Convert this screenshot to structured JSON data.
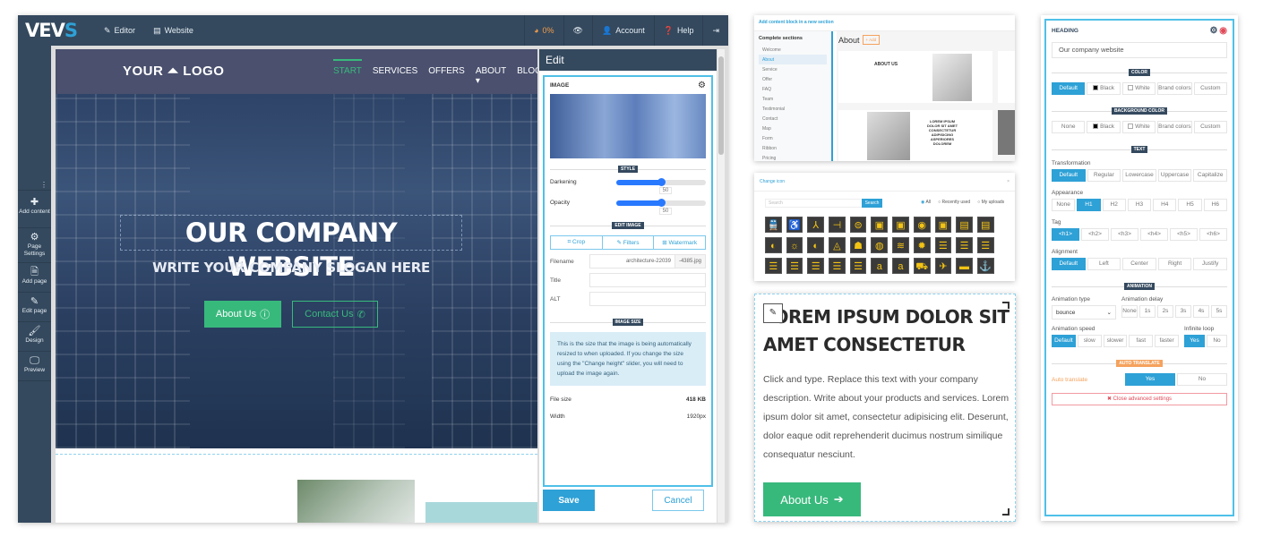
{
  "editor": {
    "topbar": {
      "logo": "VEV",
      "logo_accent": "S",
      "editor_label": "Editor",
      "website_label": "Website",
      "progress_label": "0%",
      "account_label": "Account",
      "help_label": "Help"
    },
    "sidebar": {
      "items": [
        {
          "label": "Add content",
          "icon": "plus-icon"
        },
        {
          "label": "Page Settings",
          "icon": "cogs-icon"
        },
        {
          "label": "Add page",
          "icon": "file-icon"
        },
        {
          "label": "Edit page",
          "icon": "pencil-icon"
        },
        {
          "label": "Design",
          "icon": "brush-icon"
        },
        {
          "label": "Preview",
          "icon": "monitor-icon"
        }
      ]
    },
    "site": {
      "logo_left": "YOUR",
      "logo_right": "LOGO",
      "menu": [
        "START",
        "SERVICES",
        "OFFERS",
        "ABOUT",
        "BLOG"
      ],
      "active_menu": "START",
      "hero_title": "OUR COMPANY WEBSITE",
      "hero_subtitle": "WRITE YOUR COMPANY SLOGAN HERE",
      "btn_about": "About Us",
      "btn_contact": "Contact Us"
    },
    "edit_panel": {
      "title": "Edit",
      "block_title": "IMAGE",
      "style_label": "STYLE",
      "darkening_label": "Darkening",
      "darkening_value": "50",
      "opacity_label": "Opacity",
      "opacity_value": "50",
      "edit_image_label": "EDIT IMAGE",
      "tabs": [
        "Crop",
        "Filters",
        "Watermark"
      ],
      "filename_label": "Filename",
      "filename_value": "architecture-22039",
      "filename_ext": "-4385.jpg",
      "title_label": "Title",
      "alt_label": "ALT",
      "image_size_label": "IMAGE SIZE",
      "info_text": "This is the size that the image is being automatically resized to when uploaded. If you change the size using the \"Change height\" slider, you will need to upload the image again.",
      "file_size_label": "File size",
      "file_size_value": "418 KB",
      "width_label": "Width",
      "width_value": "1920px",
      "save_label": "Save",
      "cancel_label": "Cancel"
    }
  },
  "add_content": {
    "header": "Add content block in a new section",
    "sidebar_title": "Complete sections",
    "sections": [
      "Welcome",
      "About",
      "Service",
      "Offer",
      "FAQ",
      "Team",
      "Testimonial",
      "Contact",
      "Map",
      "Form",
      "Ribbon",
      "Pricing"
    ],
    "selected": "About",
    "main_title": "About",
    "add_label": "+ Add",
    "tpl1_title": "ABOUT US",
    "tpl2_title": "LOREM IPSUM DOLOR SIT AMET CONSECTETUR ADIPISICING ASPERIORES DOLOREM"
  },
  "change_icon": {
    "title": "Change icon",
    "search_placeholder": "Search",
    "search_button": "Search",
    "radios": [
      "All",
      "Recently used",
      "My uploads"
    ],
    "selected_radio": "All",
    "icons": [
      "🚆",
      "♿",
      "⅄",
      "⊣",
      "⊜",
      "▣",
      "▣",
      "◉",
      "▣",
      "▤",
      "▤",
      "◐",
      "☼",
      "◐",
      "◬",
      "☗",
      "◍",
      "≋",
      "✹",
      "☰",
      "☰",
      "☰",
      "☰",
      "☰",
      "☰",
      "☰",
      "☰",
      "a",
      "a",
      "⛟",
      "✈",
      "▬",
      "⚓"
    ]
  },
  "text_block": {
    "heading": "LOREM IPSUM DOLOR SIT AMET CONSECTETUR",
    "paragraph": "Click and type. Replace this text with your company description. Write about your products and services. Lorem ipsum dolor sit amet, consectetur adipisicing elit. Deserunt, dolor eaque odit reprehenderit ducimus nostrum similique consequatur nesciunt.",
    "button": "About Us"
  },
  "heading_settings": {
    "title": "HEADING",
    "value": "Our company website",
    "color_label": "COLOR",
    "color_options": [
      "Default",
      "Black",
      "White",
      "Brand colors",
      "Custom"
    ],
    "color_selected": "Default",
    "bg_label": "BACKGROUND COLOR",
    "bg_options": [
      "None",
      "Black",
      "White",
      "Brand colors",
      "Custom"
    ],
    "text_label": "TEXT",
    "transformation_label": "Transformation",
    "transformation_options": [
      "Default",
      "Regular",
      "Lowercase",
      "Uppercase",
      "Capitalize"
    ],
    "appearance_label": "Appearance",
    "appearance_options": [
      "None",
      "H1",
      "H2",
      "H3",
      "H4",
      "H5",
      "H6"
    ],
    "tag_label": "Tag",
    "tag_options": [
      "<h1>",
      "<h2>",
      "<h3>",
      "<h4>",
      "<h5>",
      "<h6>"
    ],
    "alignment_label": "Alignment",
    "alignment_options": [
      "Default",
      "Left",
      "Center",
      "Right",
      "Justify"
    ],
    "animation_label": "ANIMATION",
    "animation_type_label": "Animation type",
    "animation_type_value": "bounce",
    "animation_delay_label": "Animation delay",
    "animation_delay_options": [
      "None",
      "1s",
      "2s",
      "3s",
      "4s",
      "5s"
    ],
    "animation_speed_label": "Animation speed",
    "animation_speed_options": [
      "Default",
      "slow",
      "slower",
      "fast",
      "faster"
    ],
    "infinite_loop_label": "Infinite loop",
    "infinite_loop_options": [
      "Yes",
      "No"
    ],
    "auto_translate_section": "AUTO TRANSLATE",
    "auto_translate_label": "Auto translate",
    "auto_translate_options": [
      "Yes",
      "No"
    ],
    "close_label": "Close advanced settings"
  }
}
